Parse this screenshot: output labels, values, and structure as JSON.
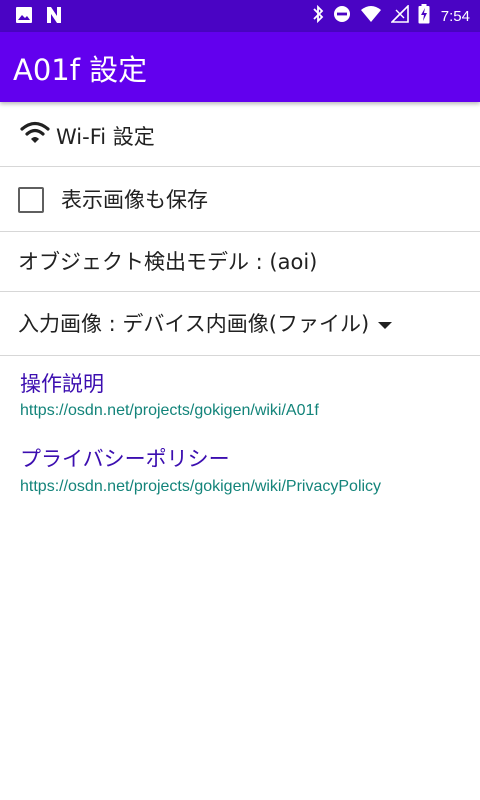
{
  "status_bar": {
    "time": "7:54",
    "left_icons": [
      "image-icon",
      "n-logo-icon"
    ],
    "right_icons": [
      "bluetooth-icon",
      "do-not-disturb-icon",
      "wifi-signal-icon",
      "cell-signal-icon",
      "battery-charging-icon"
    ]
  },
  "app_bar": {
    "title": "A01f 設定"
  },
  "settings": {
    "wifi": {
      "label": "Wi-Fi 設定",
      "icon": "wifi-icon"
    },
    "save_image": {
      "label": "表示画像も保存",
      "checked": false
    },
    "detection_model": {
      "label": "オブジェクト検出モデル : (aoi)"
    },
    "input_image": {
      "label": "入力画像 : デバイス内画像(ファイル)"
    }
  },
  "links": [
    {
      "title": "操作説明",
      "url": "https://osdn.net/projects/gokigen/wiki/A01f"
    },
    {
      "title": "プライバシーポリシー",
      "url": "https://osdn.net/projects/gokigen/wiki/PrivacyPolicy"
    }
  ],
  "colors": {
    "status_bar": "#4a04c4",
    "app_bar": "#6200ee",
    "link_title": "#3c0eb0",
    "link_url": "#13847a"
  }
}
